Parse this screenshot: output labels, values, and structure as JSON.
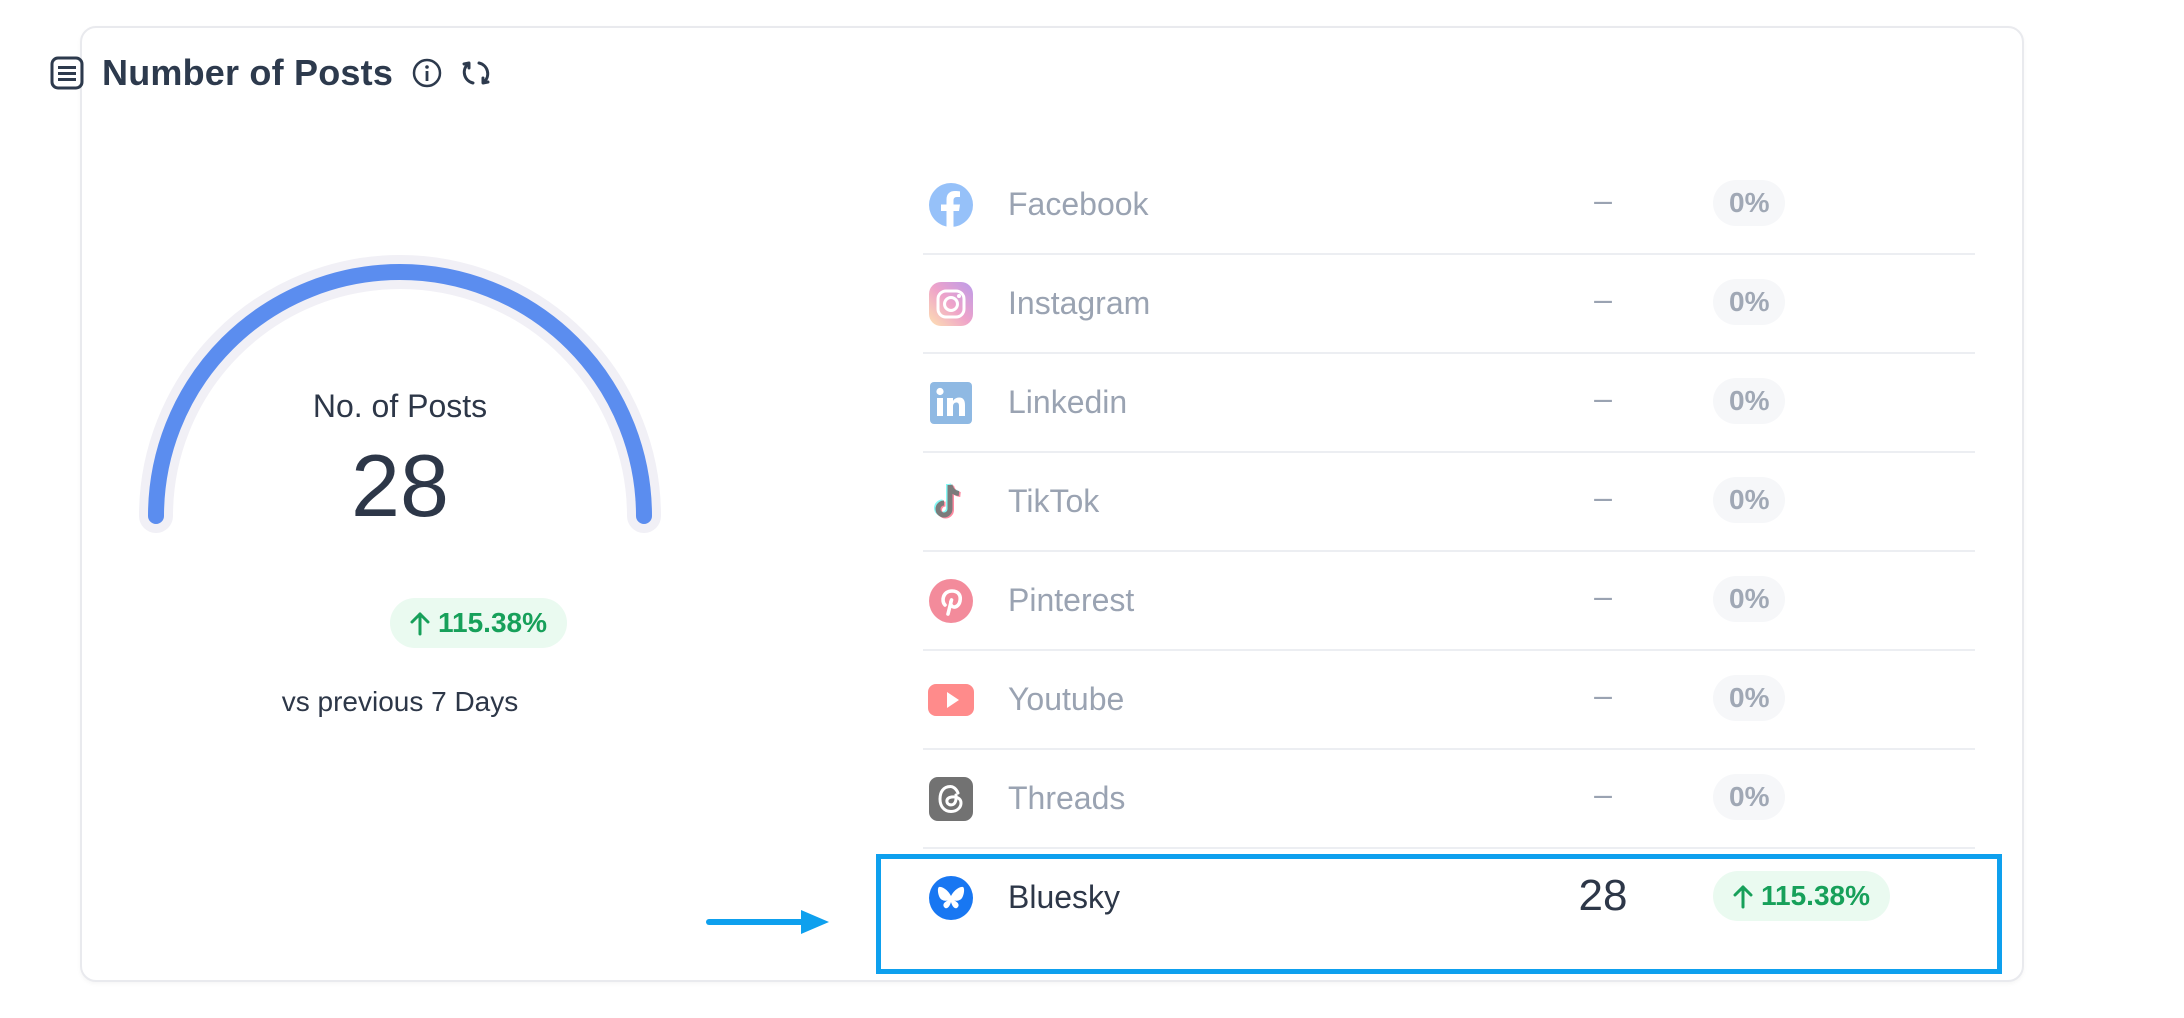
{
  "header": {
    "title": "Number of Posts",
    "title_icon": "list-icon",
    "info_icon": "info-icon",
    "refresh_icon": "refresh-icon"
  },
  "gauge": {
    "label": "No. of Posts",
    "value": "28",
    "fill_fraction": 1.0,
    "color": "#5b8def",
    "track_color": "#f1f0f6",
    "change": "115.38%",
    "change_direction": "up",
    "comparison": "vs previous 7 Days"
  },
  "networks": [
    {
      "name": "Facebook",
      "value": "–",
      "change": "0%",
      "icon": "facebook-icon",
      "color": "#1877f2"
    },
    {
      "name": "Instagram",
      "value": "–",
      "change": "0%",
      "icon": "instagram-icon",
      "color": "#e1306c"
    },
    {
      "name": "Linkedin",
      "value": "–",
      "change": "0%",
      "icon": "linkedin-icon",
      "color": "#0a66c2"
    },
    {
      "name": "TikTok",
      "value": "–",
      "change": "0%",
      "icon": "tiktok-icon",
      "color": "#111111"
    },
    {
      "name": "Pinterest",
      "value": "–",
      "change": "0%",
      "icon": "pinterest-icon",
      "color": "#e60023"
    },
    {
      "name": "Youtube",
      "value": "–",
      "change": "0%",
      "icon": "youtube-icon",
      "color": "#ff0000"
    },
    {
      "name": "Threads",
      "value": "–",
      "change": "0%",
      "icon": "threads-icon",
      "color": "#000000"
    },
    {
      "name": "Bluesky",
      "value": "28",
      "change": "115.38%",
      "change_direction": "up",
      "icon": "bluesky-icon",
      "color": "#1185fe",
      "highlighted": true
    }
  ],
  "colors": {
    "positive": "#17a05a",
    "positive_bg": "#eafaf0",
    "highlight_border": "#0ea0ee"
  }
}
